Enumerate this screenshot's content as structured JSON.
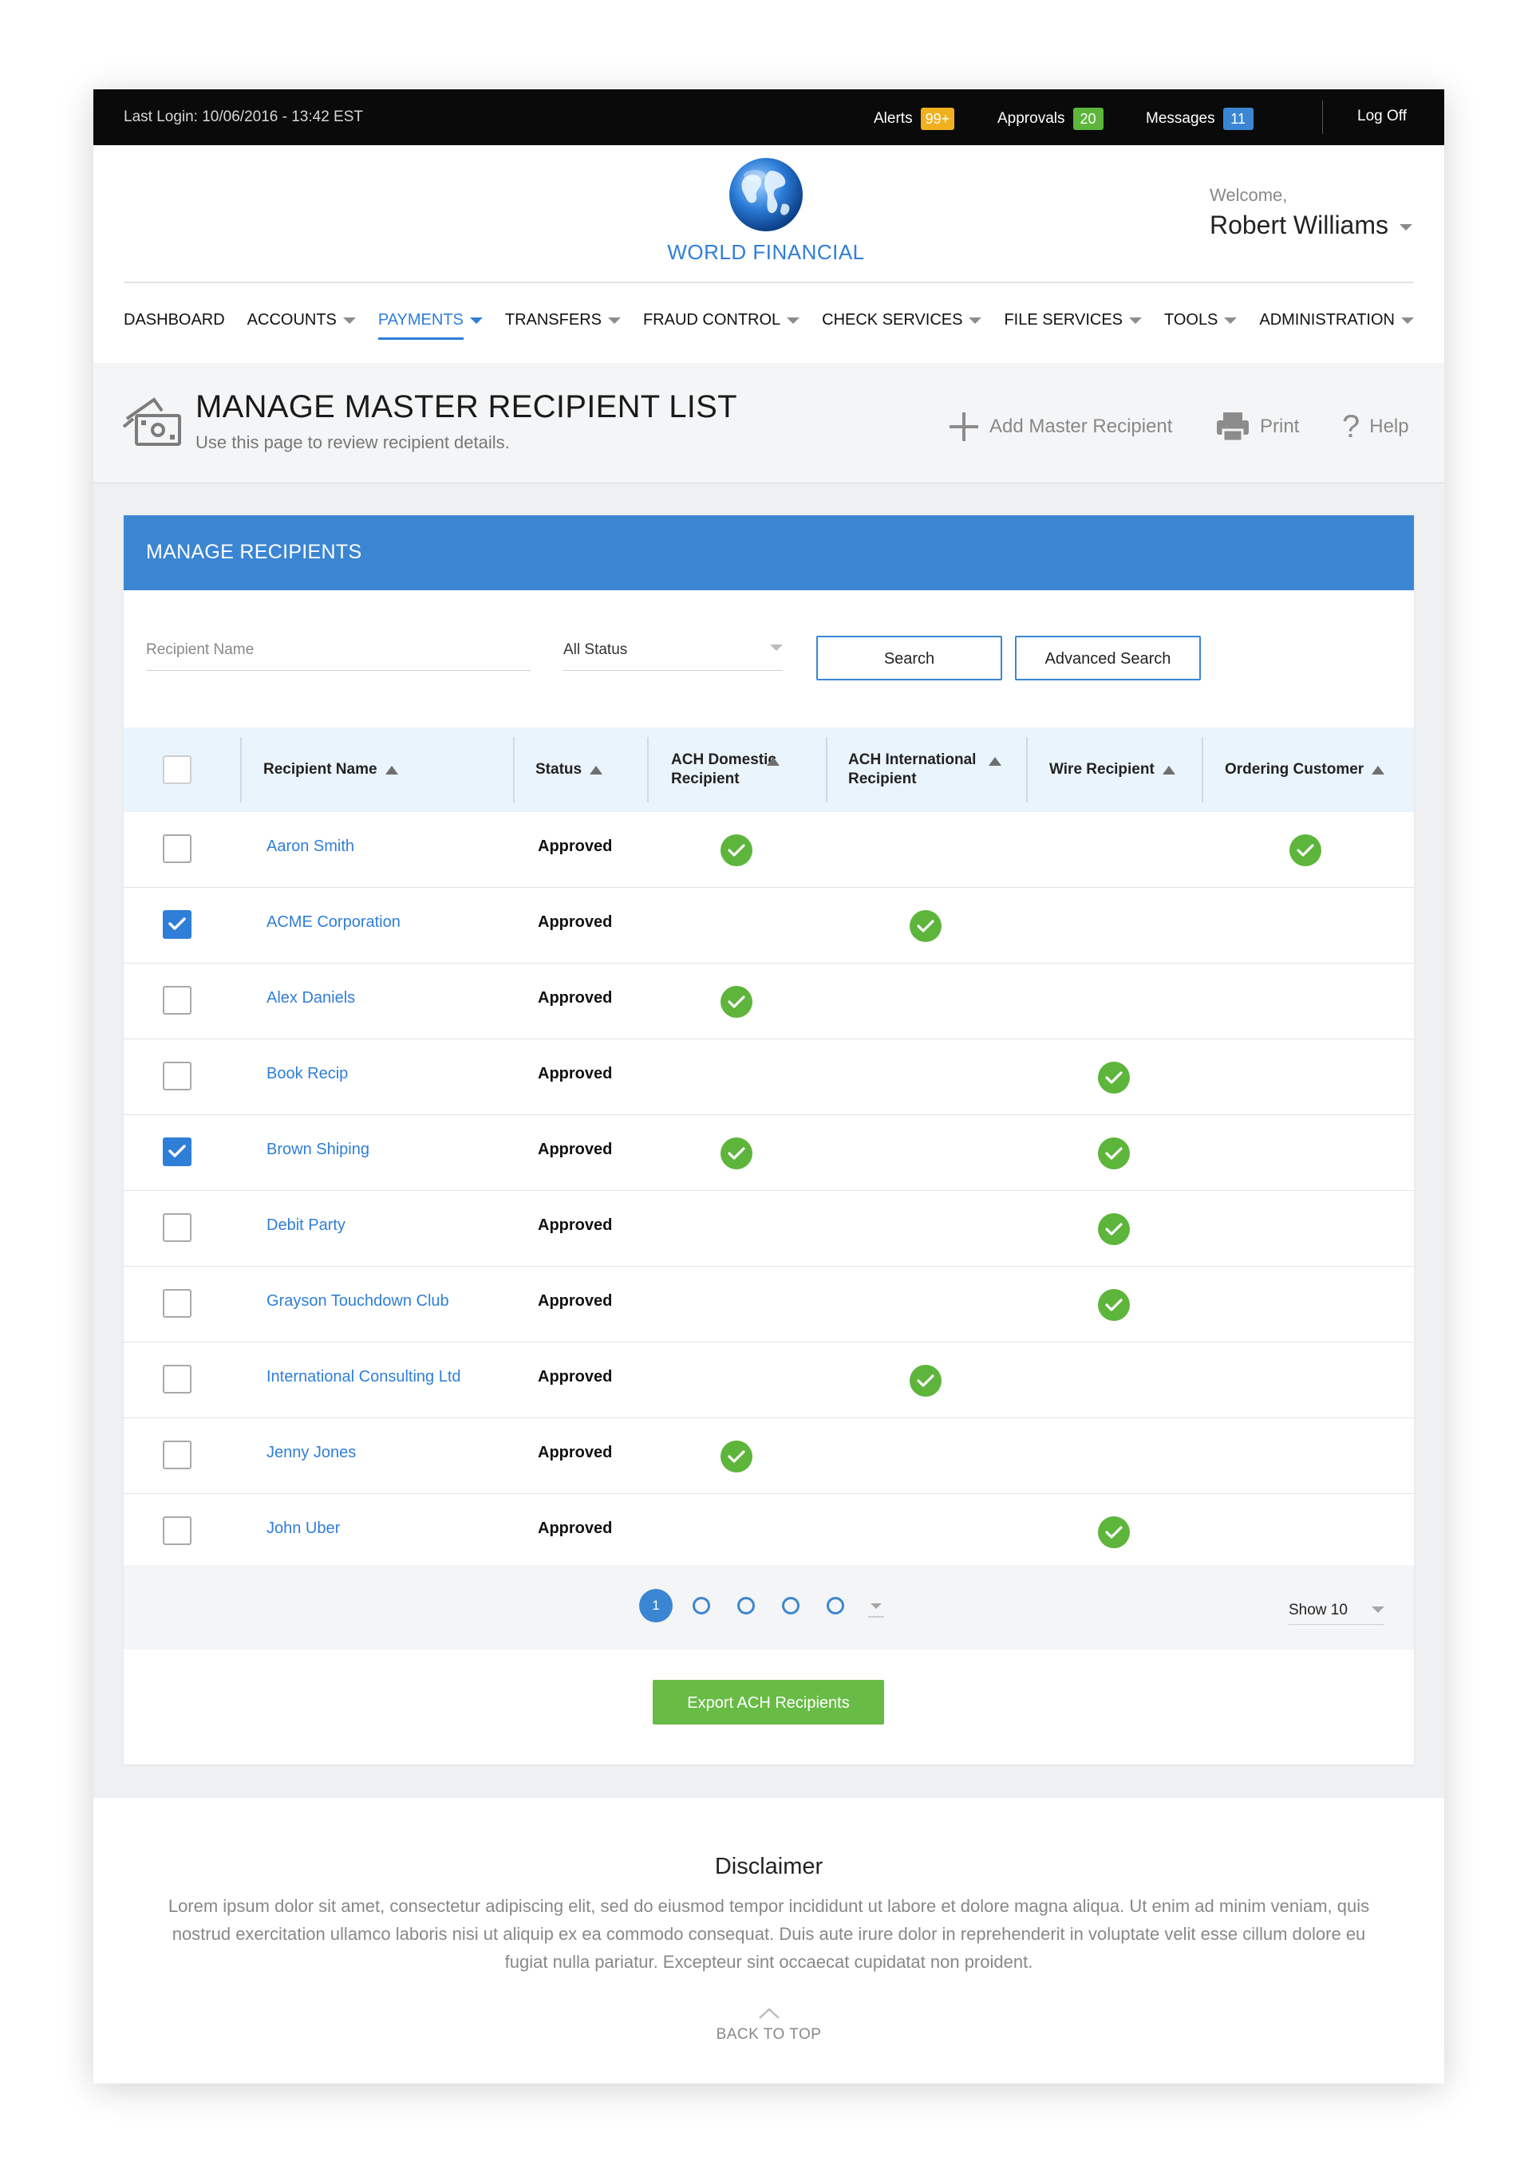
{
  "topbar": {
    "last_login": "Last Login: 10/06/2016 - 13:42 EST",
    "alerts": {
      "label": "Alerts",
      "count": "99+",
      "color": "#f0b020"
    },
    "approvals": {
      "label": "Approvals",
      "count": "20",
      "color": "#5db53c"
    },
    "messages": {
      "label": "Messages",
      "count": "11",
      "color": "#3b86d3"
    },
    "logoff": "Log Off"
  },
  "brand": {
    "name": "WORLD FINANCIAL",
    "accent": "#2f7ed8"
  },
  "user": {
    "greeting": "Welcome,",
    "name": "Robert Williams"
  },
  "nav": [
    {
      "label": "DASHBOARD",
      "has_caret": false,
      "active": false
    },
    {
      "label": "ACCOUNTS",
      "has_caret": true,
      "active": false
    },
    {
      "label": "PAYMENTS",
      "has_caret": true,
      "active": true
    },
    {
      "label": "TRANSFERS",
      "has_caret": true,
      "active": false
    },
    {
      "label": "FRAUD CONTROL",
      "has_caret": true,
      "active": false
    },
    {
      "label": "CHECK SERVICES",
      "has_caret": true,
      "active": false
    },
    {
      "label": "FILE SERVICES",
      "has_caret": true,
      "active": false
    },
    {
      "label": "TOOLS",
      "has_caret": true,
      "active": false
    },
    {
      "label": "ADMINISTRATION",
      "has_caret": true,
      "active": false
    }
  ],
  "page": {
    "title": "MANAGE MASTER RECIPIENT LIST",
    "subtitle": "Use this page to review recipient details.",
    "icon": "money-icon",
    "actions": {
      "add": "Add Master Recipient",
      "print": "Print",
      "help": "Help"
    }
  },
  "panel": {
    "title": "MANAGE RECIPIENTS",
    "search_placeholder": "Recipient Name",
    "status_filter": "All Status",
    "search_button": "Search",
    "advanced_search_button": "Advanced Search"
  },
  "table": {
    "columns": {
      "name": "Recipient Name",
      "status": "Status",
      "ach_domestic": "ACH Domestic Recipient",
      "ach_international": "ACH International Recipient",
      "wire": "Wire Recipient",
      "ordering": "Ordering Customer"
    },
    "rows": [
      {
        "name": "Aaron Smith",
        "status": "Approved",
        "checked": false,
        "ach_domestic": true,
        "ach_international": false,
        "wire": false,
        "ordering": true
      },
      {
        "name": "ACME Corporation",
        "status": "Approved",
        "checked": true,
        "ach_domestic": false,
        "ach_international": true,
        "wire": false,
        "ordering": false
      },
      {
        "name": "Alex Daniels",
        "status": "Approved",
        "checked": false,
        "ach_domestic": true,
        "ach_international": false,
        "wire": false,
        "ordering": false
      },
      {
        "name": "Book Recip",
        "status": "Approved",
        "checked": false,
        "ach_domestic": false,
        "ach_international": false,
        "wire": true,
        "ordering": false
      },
      {
        "name": "Brown Shiping",
        "status": "Approved",
        "checked": true,
        "ach_domestic": true,
        "ach_international": false,
        "wire": true,
        "ordering": false
      },
      {
        "name": "Debit Party",
        "status": "Approved",
        "checked": false,
        "ach_domestic": false,
        "ach_international": false,
        "wire": true,
        "ordering": false
      },
      {
        "name": "Grayson Touchdown Club",
        "status": "Approved",
        "checked": false,
        "ach_domestic": false,
        "ach_international": false,
        "wire": true,
        "ordering": false
      },
      {
        "name": "International Consulting Ltd",
        "status": "Approved",
        "checked": false,
        "ach_domestic": false,
        "ach_international": true,
        "wire": false,
        "ordering": false
      },
      {
        "name": "Jenny Jones",
        "status": "Approved",
        "checked": false,
        "ach_domestic": true,
        "ach_international": false,
        "wire": false,
        "ordering": false
      },
      {
        "name": "John Uber",
        "status": "Approved",
        "checked": false,
        "ach_domestic": false,
        "ach_international": false,
        "wire": true,
        "ordering": false
      }
    ]
  },
  "pagination": {
    "current": "1",
    "total_pages": 5,
    "show_label": "Show 10"
  },
  "export_button": "Export ACH Recipients",
  "footer": {
    "disclaimer_title": "Disclaimer",
    "disclaimer_text": "Lorem ipsum dolor sit amet, consectetur adipiscing elit, sed do eiusmod tempor incididunt ut labore et dolore magna aliqua. Ut enim ad minim veniam, quis nostrud exercitation ullamco laboris nisi ut aliquip ex ea commodo consequat. Duis aute irure dolor in reprehenderit in voluptate velit esse cillum dolore eu fugiat nulla pariatur. Excepteur sint occaecat cupidatat non proident.",
    "back_to_top": "BACK TO TOP"
  }
}
